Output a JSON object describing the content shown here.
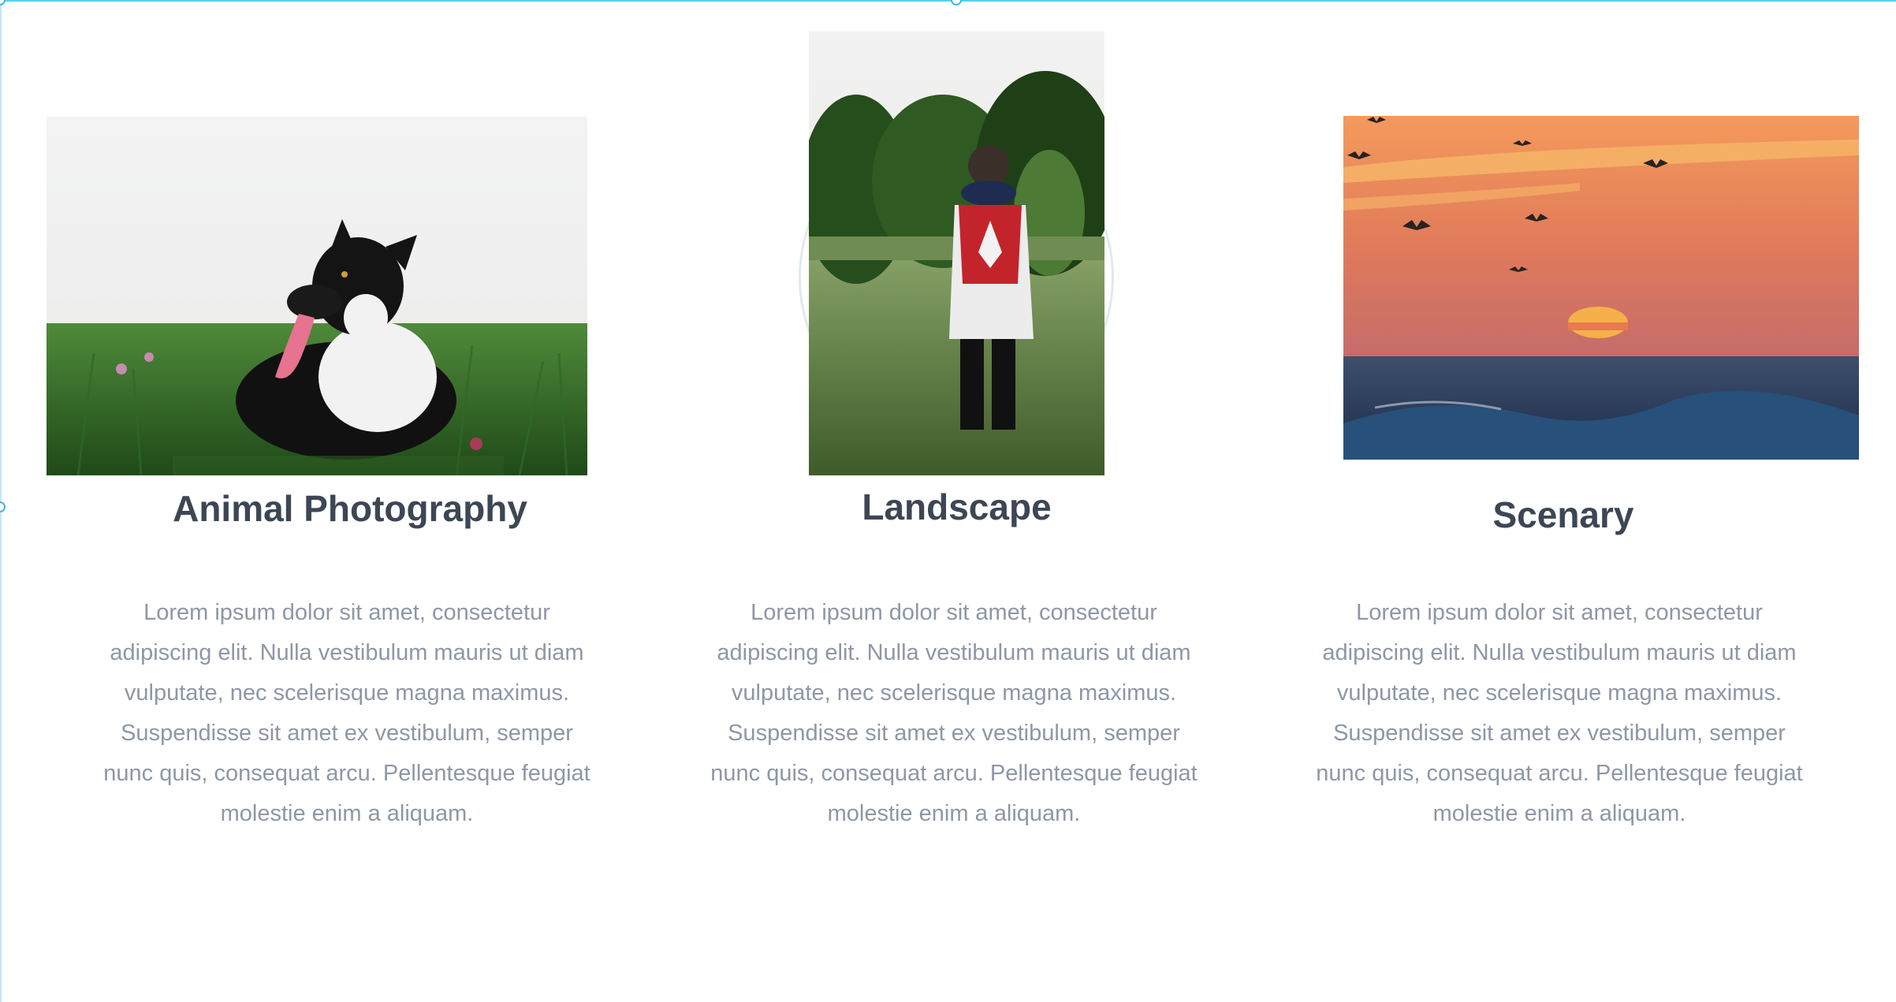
{
  "columns": [
    {
      "title": "Animal Photography",
      "image_icon": "dog-photo",
      "body": "Lorem ipsum dolor sit amet, consectetur adipiscing elit. Nulla vestibulum mauris ut diam vulputate, nec scelerisque magna maximus. Suspendisse sit amet ex vestibulum, semper nunc quis, consequat arcu. Pellentesque feugiat molestie enim a aliquam."
    },
    {
      "title": "Landscape",
      "image_icon": "child-with-flag-photo",
      "body": "Lorem ipsum dolor sit amet, consectetur adipiscing elit. Nulla vestibulum mauris ut diam vulputate, nec scelerisque magna maximus. Suspendisse sit amet ex vestibulum, semper nunc quis, consequat arcu. Pellentesque feugiat molestie enim a aliquam."
    },
    {
      "title": "Scenary",
      "image_icon": "sunset-sea-photo",
      "body": "Lorem ipsum dolor sit amet, consectetur adipiscing elit. Nulla vestibulum mauris ut diam vulputate, nec scelerisque magna maximus. Suspendisse sit amet ex vestibulum, semper nunc quis, consequat arcu. Pellentesque feugiat molestie enim a aliquam."
    }
  ],
  "colors": {
    "title": "#3d4654",
    "body": "#8e97a6",
    "selection": "#5bd0ee"
  }
}
